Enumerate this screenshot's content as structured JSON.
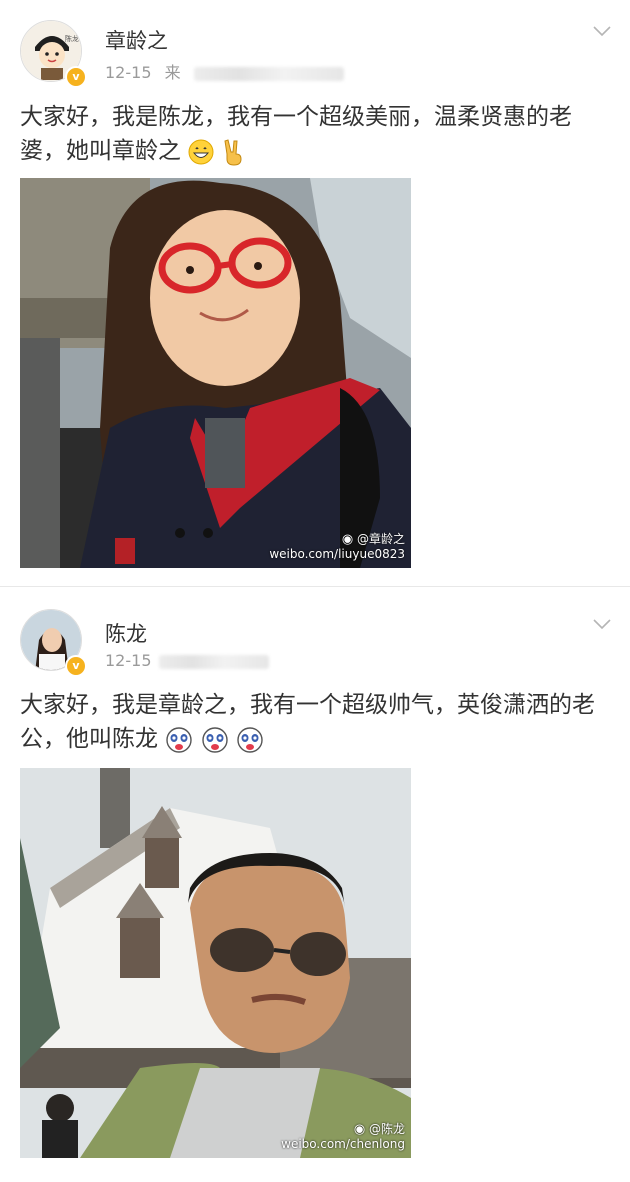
{
  "posts": [
    {
      "user": {
        "name": "章龄之",
        "verified_badge": "v",
        "avatar_icon": "cartoon-avatar-icon"
      },
      "meta": {
        "date": "12-15",
        "source_prefix": "来"
      },
      "text": "大家好，我是陈龙，我有一个超级美丽，温柔贤惠的老婆，她叫章龄之",
      "emojis": [
        "grin-emoji-icon",
        "victory-hand-icon"
      ],
      "photo": {
        "watermark_handle": "@章龄之",
        "watermark_url": "weibo.com/liuyue0823",
        "icon": "weibo-icon"
      }
    },
    {
      "user": {
        "name": "陈龙",
        "verified_badge": "v",
        "avatar_icon": "photo-avatar-icon"
      },
      "meta": {
        "date": "12-15"
      },
      "text": "大家好，我是章龄之，我有一个超级帅气，英俊潇洒的老公，他叫陈龙",
      "emojis": [
        "panda-face-emoji-icon",
        "panda-face-emoji-icon",
        "panda-face-emoji-icon"
      ],
      "photo": {
        "watermark_handle": "@陈龙",
        "watermark_url": "weibo.com/chenlong",
        "icon": "weibo-icon"
      }
    }
  ],
  "colors": {
    "verified": "#f6b21e",
    "text": "#333333",
    "meta": "#9a9a9a"
  }
}
